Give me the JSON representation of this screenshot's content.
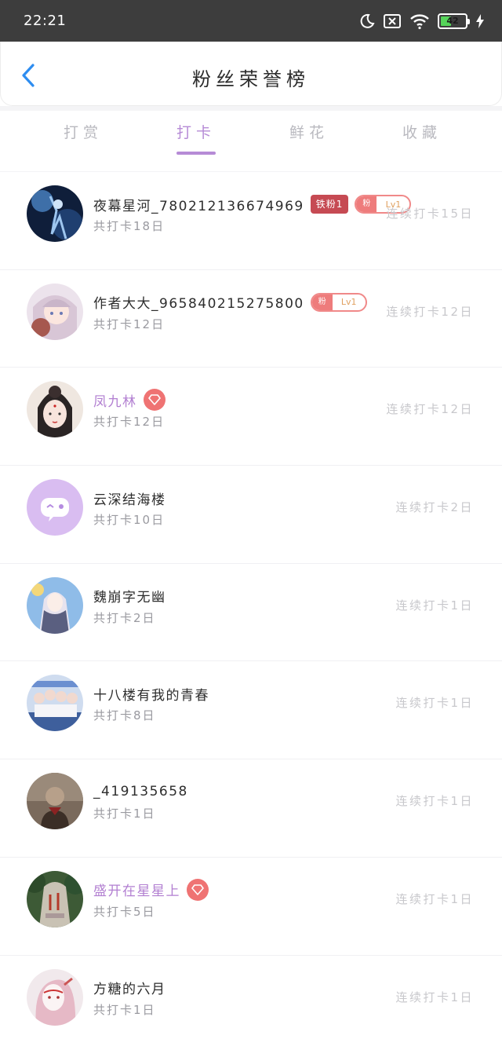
{
  "status_bar": {
    "time": "22:21",
    "battery": "42",
    "battery_level": 0.42
  },
  "header": {
    "title": "粉丝荣誉榜"
  },
  "tabs": [
    {
      "label": "打赏",
      "active": false
    },
    {
      "label": "打卡",
      "active": true
    },
    {
      "label": "鲜花",
      "active": false
    },
    {
      "label": "收藏",
      "active": false
    }
  ],
  "fans": [
    {
      "name": "夜幕星河_780212136674969",
      "name_color": "default",
      "badge_iron": "铁粉1",
      "badge_fan": {
        "left": "粉",
        "right": "Lv1"
      },
      "total": "共打卡18日",
      "streak": "连续打卡15日"
    },
    {
      "name": "作者大大_965840215275800",
      "name_color": "default",
      "badge_fan": {
        "left": "粉",
        "right": "Lv1"
      },
      "total": "共打卡12日",
      "streak": "连续打卡12日"
    },
    {
      "name": "凤九林",
      "name_color": "purple",
      "gem": true,
      "total": "共打卡12日",
      "streak": "连续打卡12日"
    },
    {
      "name": "云深结海楼",
      "name_color": "default",
      "total": "共打卡10日",
      "streak": "连续打卡2日"
    },
    {
      "name": "魏崩字无幽",
      "name_color": "default",
      "total": "共打卡2日",
      "streak": "连续打卡1日"
    },
    {
      "name": "十八楼有我的青春",
      "name_color": "default",
      "total": "共打卡8日",
      "streak": "连续打卡1日"
    },
    {
      "name": "_419135658",
      "name_color": "default",
      "total": "共打卡1日",
      "streak": "连续打卡1日"
    },
    {
      "name": "盛开在星星上",
      "name_color": "purple",
      "gem": true,
      "total": "共打卡5日",
      "streak": "连续打卡1日"
    },
    {
      "name": "方糖的六月",
      "name_color": "default",
      "total": "共打卡1日",
      "streak": "连续打卡1日"
    }
  ]
}
